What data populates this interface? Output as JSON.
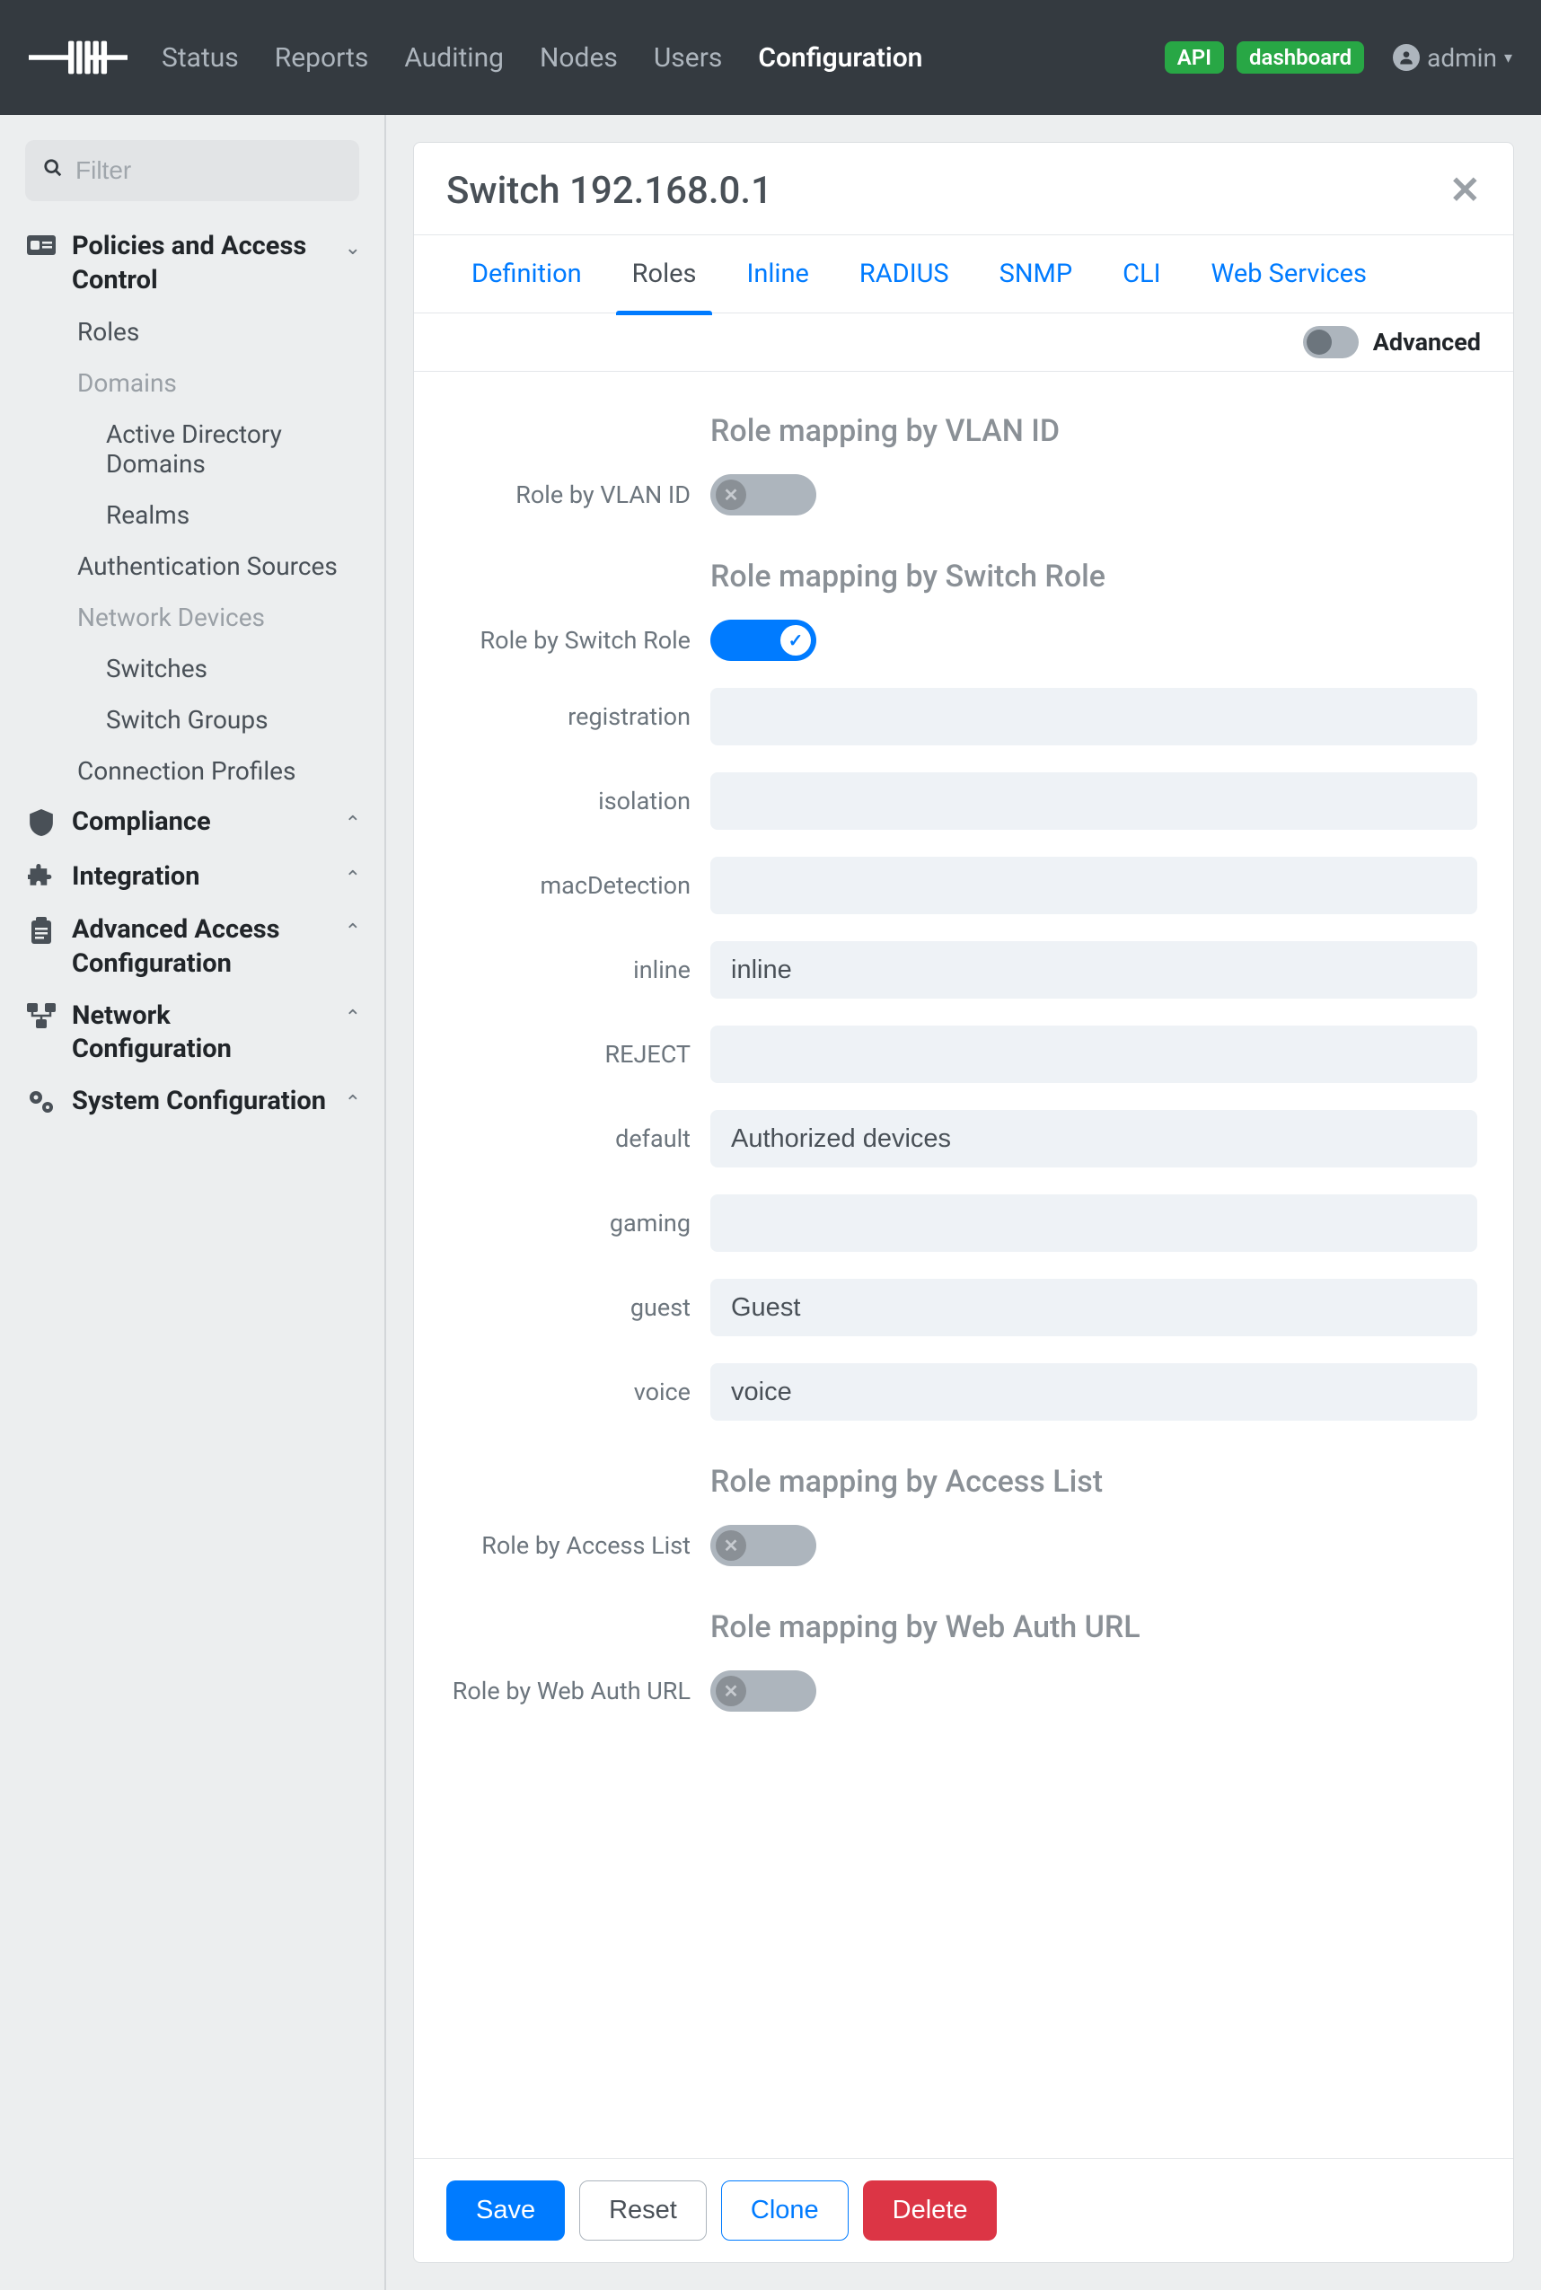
{
  "nav": {
    "links": [
      "Status",
      "Reports",
      "Auditing",
      "Nodes",
      "Users",
      "Configuration"
    ],
    "active_index": 5,
    "api_badge": "API",
    "dashboard_badge": "dashboard",
    "user": "admin"
  },
  "sidebar": {
    "filter_placeholder": "Filter",
    "sections": {
      "policies": {
        "label": "Policies and Access Control",
        "roles": "Roles",
        "domains_label": "Domains",
        "active_directory": "Active Directory Domains",
        "realms": "Realms",
        "auth_sources": "Authentication Sources",
        "network_devices_label": "Network Devices",
        "switches": "Switches",
        "switch_groups": "Switch Groups",
        "connection_profiles": "Connection Profiles"
      },
      "compliance": "Compliance",
      "integration": "Integration",
      "advanced_access": "Advanced Access Configuration",
      "network_config": "Network Configuration",
      "system_config": "System Configuration"
    }
  },
  "main": {
    "title": "Switch 192.168.0.1",
    "tabs": [
      "Definition",
      "Roles",
      "Inline",
      "RADIUS",
      "SNMP",
      "CLI",
      "Web Services"
    ],
    "active_tab_index": 1,
    "advanced_label": "Advanced",
    "advanced_on": false,
    "sections": {
      "vlan": {
        "title": "Role mapping by VLAN ID",
        "toggle_label": "Role by VLAN ID",
        "on": false
      },
      "switch_role": {
        "title": "Role mapping by Switch Role",
        "toggle_label": "Role by Switch Role",
        "on": true,
        "fields": [
          {
            "label": "registration",
            "value": ""
          },
          {
            "label": "isolation",
            "value": ""
          },
          {
            "label": "macDetection",
            "value": ""
          },
          {
            "label": "inline",
            "value": "inline"
          },
          {
            "label": "REJECT",
            "value": ""
          },
          {
            "label": "default",
            "value": "Authorized devices"
          },
          {
            "label": "gaming",
            "value": ""
          },
          {
            "label": "guest",
            "value": "Guest"
          },
          {
            "label": "voice",
            "value": "voice"
          }
        ]
      },
      "access_list": {
        "title": "Role mapping by Access List",
        "toggle_label": "Role by Access List",
        "on": false
      },
      "web_auth": {
        "title": "Role mapping by Web Auth URL",
        "toggle_label": "Role by Web Auth URL",
        "on": false
      }
    },
    "footer": {
      "save": "Save",
      "reset": "Reset",
      "clone": "Clone",
      "delete": "Delete"
    }
  }
}
